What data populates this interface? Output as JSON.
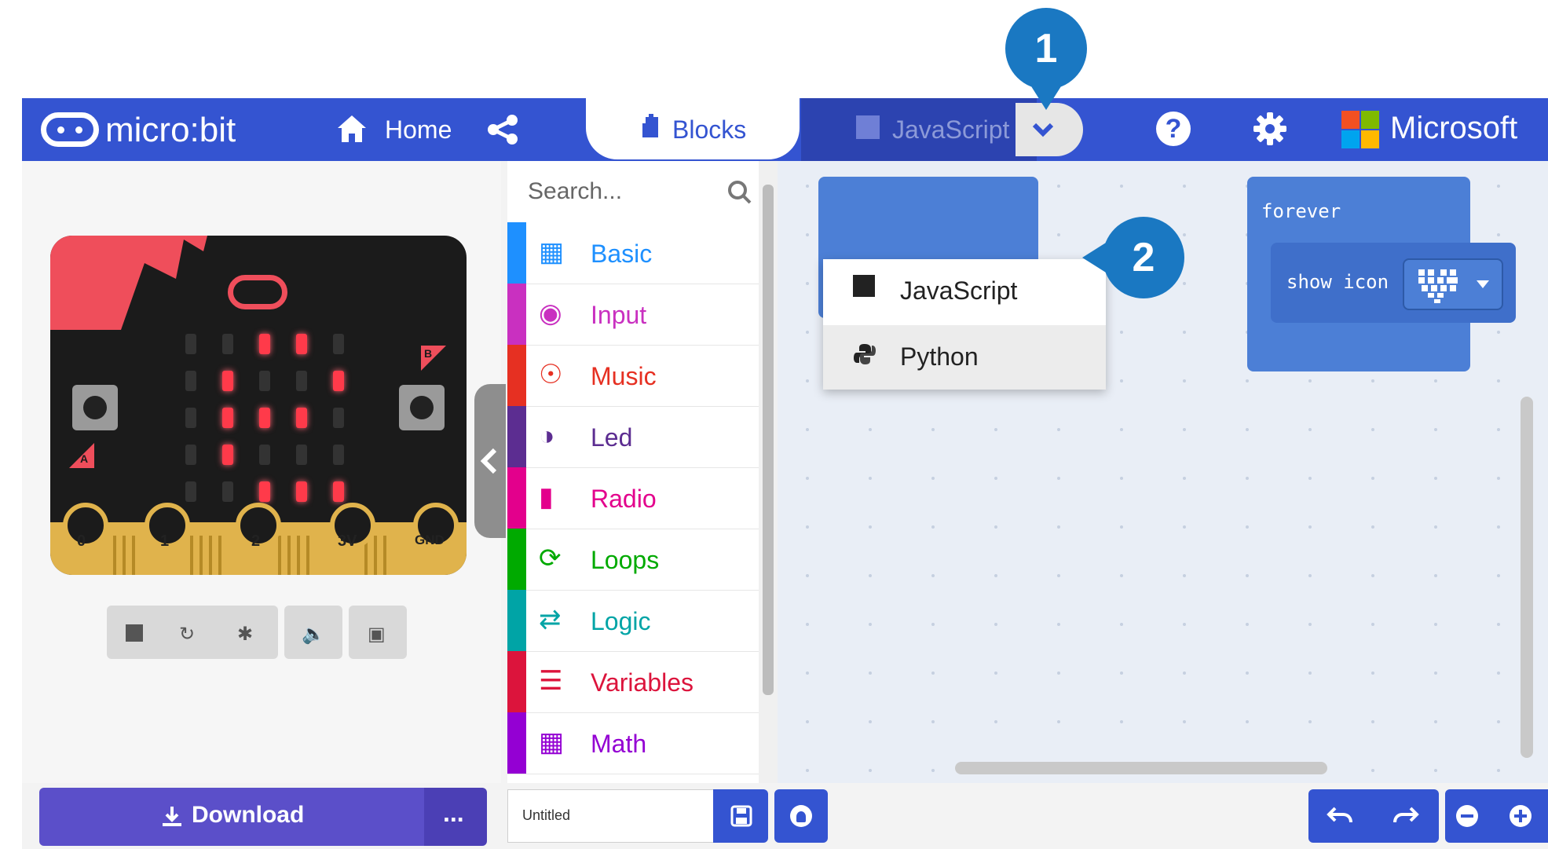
{
  "header": {
    "brand": "micro:bit",
    "home_label": "Home",
    "tab_blocks": "Blocks",
    "tab_javascript": "JavaScript",
    "microsoft": "Microsoft"
  },
  "language_menu": {
    "items": [
      {
        "label": "JavaScript",
        "icon": "js-icon"
      },
      {
        "label": "Python",
        "icon": "python-icon"
      }
    ]
  },
  "callouts": {
    "one": "1",
    "two": "2"
  },
  "toolbox": {
    "search_placeholder": "Search...",
    "categories": [
      {
        "label": "Basic",
        "color": "#1e90ff",
        "icon": "grid-icon"
      },
      {
        "label": "Input",
        "color": "#c930c0",
        "icon": "target-icon"
      },
      {
        "label": "Music",
        "color": "#e63022",
        "icon": "headphones-icon"
      },
      {
        "label": "Led",
        "color": "#5c2d91",
        "icon": "toggle-icon"
      },
      {
        "label": "Radio",
        "color": "#e3008c",
        "icon": "signal-bars-icon"
      },
      {
        "label": "Loops",
        "color": "#00aa00",
        "icon": "loop-arrow-icon"
      },
      {
        "label": "Logic",
        "color": "#00a4a6",
        "icon": "shuffle-icon"
      },
      {
        "label": "Variables",
        "color": "#dc143c",
        "icon": "lines-icon"
      },
      {
        "label": "Math",
        "color": "#9400d3",
        "icon": "calculator-icon"
      }
    ]
  },
  "simulator": {
    "pins": [
      "0",
      "1",
      "2",
      "3V",
      "GND"
    ],
    "button_a": "A",
    "button_b": "B"
  },
  "workspace": {
    "forever_label": "forever",
    "show_icon_label": "show icon"
  },
  "footer": {
    "download_label": "Download",
    "more_label": "...",
    "project_name": "Untitled"
  },
  "colors": {
    "header": "#3454d1",
    "download": "#5b4fc9",
    "accent_blue": "#4c7fd6",
    "callout": "#1a78c2"
  }
}
